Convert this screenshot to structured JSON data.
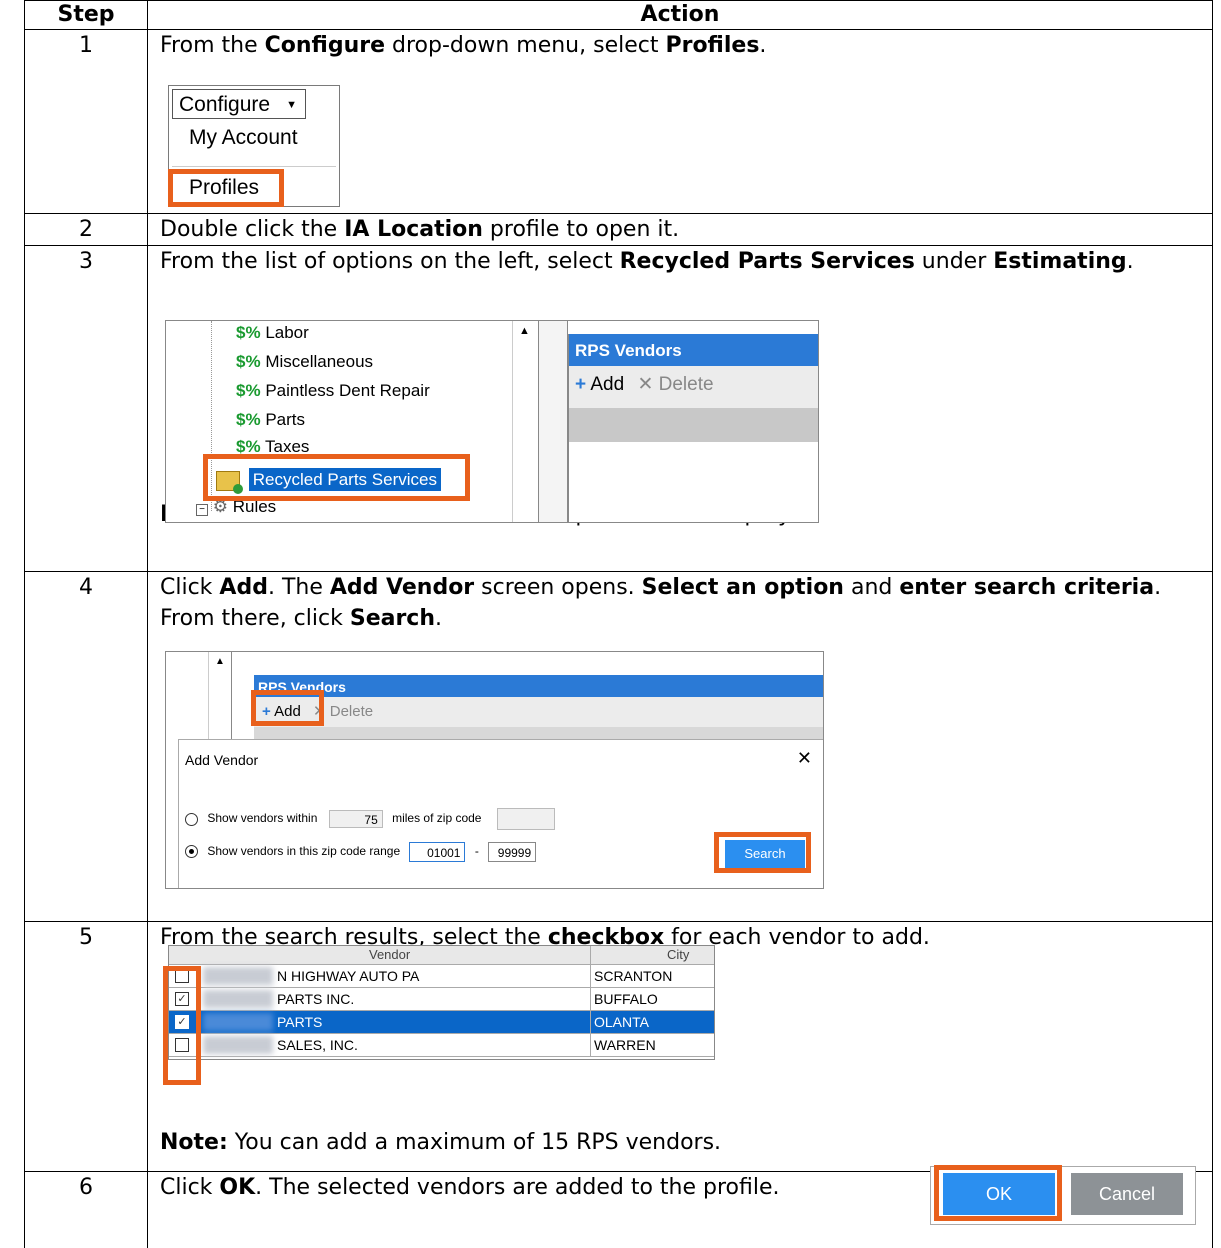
{
  "headers": {
    "step": "Step",
    "action": "Action"
  },
  "steps": [
    {
      "num": "1",
      "parts": [
        "From the ",
        "Configure",
        " drop-down menu, select ",
        "Profiles",
        "."
      ]
    },
    {
      "num": "2",
      "parts": [
        "Double click the ",
        "IA Location",
        " profile to open it."
      ]
    },
    {
      "num": "3",
      "parts": [
        "From the list of options on the left, select ",
        "Recycled Parts Services",
        " under ",
        "Estimating",
        "."
      ],
      "note_label": "Note:",
      "note": " The RPS Vendors and retrieval preferences display."
    },
    {
      "num": "4",
      "parts": [
        "Click ",
        "Add",
        ". The ",
        "Add Vendor",
        " screen opens. ",
        "Select an option",
        " and ",
        "enter search criteria",
        ". From there, click ",
        "Search",
        "."
      ]
    },
    {
      "num": "5",
      "parts": [
        "From the search results, select the ",
        "checkbox",
        " for each vendor to add."
      ],
      "note_label": "Note:",
      "note": " You can add a maximum of 15 RPS vendors."
    },
    {
      "num": "6",
      "parts": [
        "Click ",
        "OK",
        ". The selected vendors are added to the profile."
      ]
    }
  ],
  "shot1": {
    "menu": "Configure",
    "item1": "My Account",
    "item2": "Profiles"
  },
  "shot2": {
    "tree": [
      "$%",
      "Labor",
      "Miscellaneous",
      "Paintless Dent Repair",
      "Parts",
      "Taxes",
      "Recycled Parts Services",
      "Rules"
    ],
    "panel_title": "RPS Vendors",
    "add": "Add",
    "delete": "Delete"
  },
  "shot3": {
    "panel_title": "RPS Vendors",
    "add": "Add",
    "delete": "Delete",
    "dialog_title": "Add Vendor",
    "opt1": "Show vendors within",
    "miles": "75",
    "opt1b": "miles of zip code",
    "opt2": "Show vendors in this zip code range",
    "zip_from": "01001",
    "dash": "-",
    "zip_to": "99999",
    "search": "Search"
  },
  "shot4": {
    "col_vendor": "Vendor",
    "col_city": "City",
    "rows": [
      {
        "vendor": "N HIGHWAY AUTO PA",
        "city": "SCRANTON",
        "checked": false,
        "selected": false
      },
      {
        "vendor": "PARTS INC.",
        "city": "BUFFALO",
        "checked": true,
        "selected": false
      },
      {
        "vendor": "PARTS",
        "city": "OLANTA",
        "checked": true,
        "selected": true
      },
      {
        "vendor": "SALES, INC.",
        "city": "WARREN",
        "checked": false,
        "selected": false
      }
    ]
  },
  "shot5": {
    "ok": "OK",
    "cancel": "Cancel"
  },
  "colors": {
    "accent": "#e8601c",
    "blue": "#2b7ad6",
    "selected": "#0a66c8"
  }
}
